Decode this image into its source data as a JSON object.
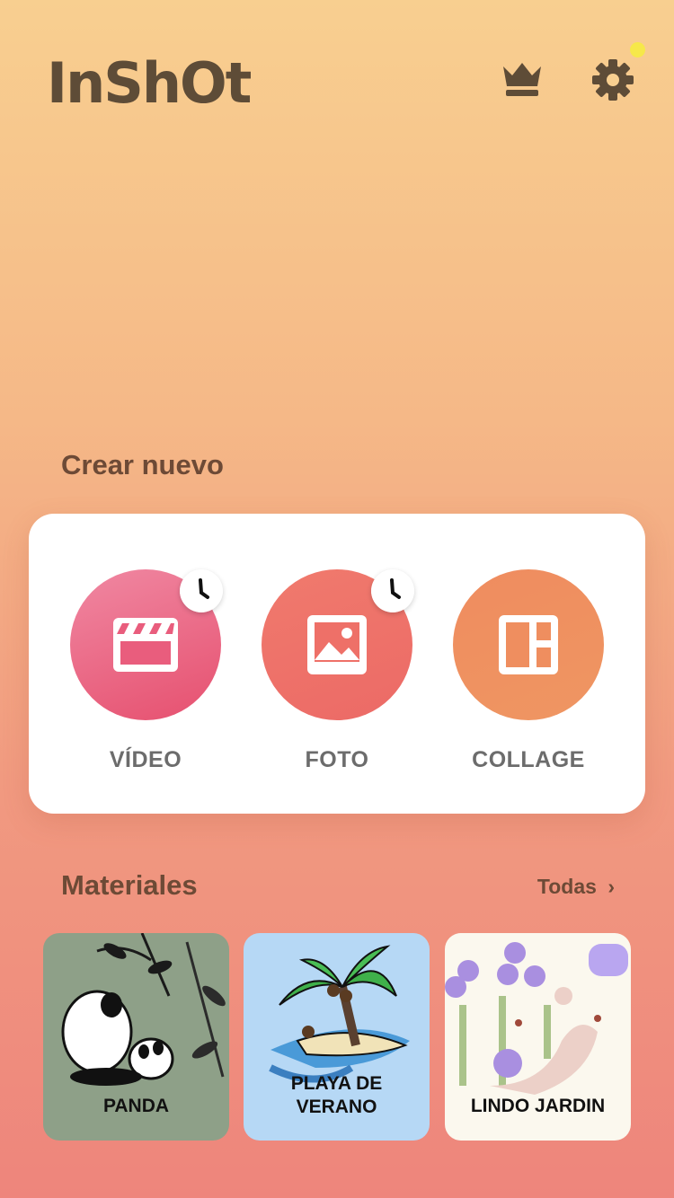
{
  "header": {
    "logo_text": "InShOt",
    "premium_icon": "crown-icon",
    "settings_icon": "gear-icon"
  },
  "create": {
    "title": "Crear nuevo",
    "tools": [
      {
        "label": "VÍDEO",
        "icon": "clapperboard-icon",
        "has_recent": true
      },
      {
        "label": "FOTO",
        "icon": "image-icon",
        "has_recent": true
      },
      {
        "label": "COLLAGE",
        "icon": "collage-icon",
        "has_recent": false
      }
    ]
  },
  "materials": {
    "title": "Materiales",
    "see_all": "Todas",
    "items": [
      {
        "label": "PANDA"
      },
      {
        "label": "PLAYA DE VERANO"
      },
      {
        "label": "LINDO JARDIN"
      }
    ]
  },
  "colors": {
    "brand_text": "#5e4c37",
    "video": "#ea5f80",
    "foto": "#ee6f66",
    "collage": "#ee8a5a"
  }
}
